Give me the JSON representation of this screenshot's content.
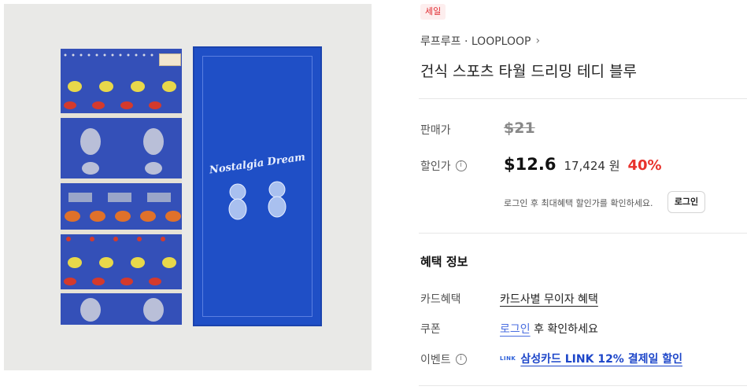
{
  "badge": {
    "sale": "세일"
  },
  "brand": {
    "name": "루프루프 · LOOPLOOP",
    "chevron": "chevron-right-icon"
  },
  "product": {
    "title": "건식 스포츠 타월 드리밍 테디 블루",
    "image_text": "Nostalgia Dream"
  },
  "price": {
    "list_label": "판매가",
    "list_price": "$21",
    "sale_label": "할인가",
    "sale_price": "$12.6",
    "krw_price": "17,424 원",
    "discount": "40%",
    "login_note": "로그인 후 최대혜택 할인가를 확인하세요.",
    "login_button": "로그인"
  },
  "benefits": {
    "title": "혜택 정보",
    "card_label": "카드혜택",
    "card_value": "카드사별 무이자 혜택",
    "coupon_label": "쿠폰",
    "coupon_link": "로그인",
    "coupon_suffix": "후 확인하세요",
    "event_label": "이벤트",
    "event_badge": "LINK",
    "event_value": "삼성카드 LINK 12% 결제일 할인"
  },
  "colors": {
    "accent_red": "#e8322c",
    "link_blue": "#1d46c9",
    "towel_blue": "#1f4fc6"
  }
}
